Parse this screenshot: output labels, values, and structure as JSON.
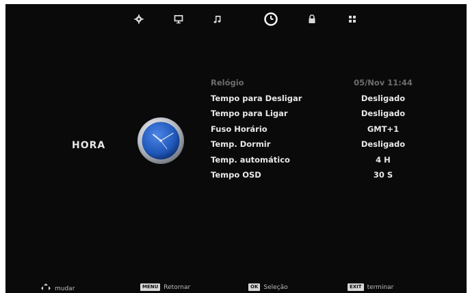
{
  "tabs": [
    {
      "name": "settings-gear-icon",
      "active": false
    },
    {
      "name": "monitor-icon",
      "active": false
    },
    {
      "name": "music-note-icon",
      "active": false
    },
    {
      "name": "clock-icon",
      "active": true
    },
    {
      "name": "lock-icon",
      "active": false
    },
    {
      "name": "grid-icon",
      "active": false
    }
  ],
  "section": {
    "title": "HORA",
    "icon": "analog-clock-icon"
  },
  "menu": {
    "items": [
      {
        "label": "Relógio",
        "value": "05/Nov 11:44",
        "disabled": true
      },
      {
        "label": "Tempo para Desligar",
        "value": "Desligado"
      },
      {
        "label": "Tempo para Ligar",
        "value": "Desligado"
      },
      {
        "label": "Fuso Horário",
        "value": "GMT+1"
      },
      {
        "label": "Temp. Dormir",
        "value": "Desligado"
      },
      {
        "label": "Temp. automático",
        "value": "4 H"
      },
      {
        "label": "Tempo OSD",
        "value": "30 S"
      }
    ]
  },
  "footer": {
    "move_label": "mudar",
    "menu_key": "MENU",
    "menu_label": "Retornar",
    "ok_key": "OK",
    "ok_label": "Seleção",
    "exit_key": "EXIT",
    "exit_label": "terminar"
  },
  "colors": {
    "background": "#0a0a0a",
    "text": "#e8e8e8",
    "disabled_text": "#6d6d6d",
    "clock_blue": "#1f57b8"
  }
}
